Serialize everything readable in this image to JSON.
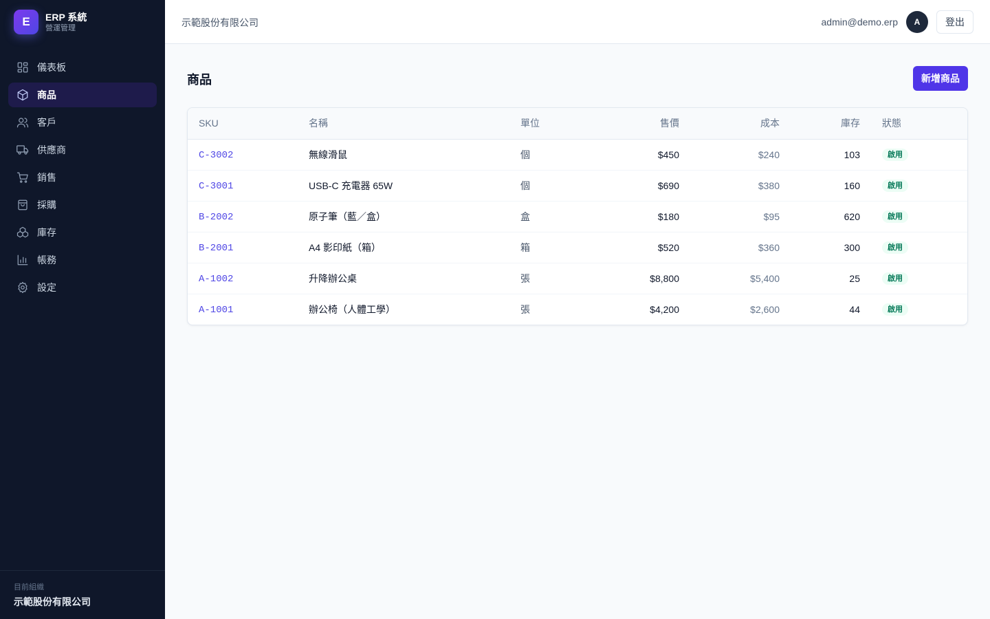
{
  "brand": {
    "logo_letter": "E",
    "title": "ERP 系統",
    "subtitle": "營運管理"
  },
  "sidebar": {
    "items": [
      {
        "label": "儀表板",
        "icon": "dashboard-icon",
        "active": false
      },
      {
        "label": "商品",
        "icon": "box-icon",
        "active": true
      },
      {
        "label": "客戶",
        "icon": "users-icon",
        "active": false
      },
      {
        "label": "供應商",
        "icon": "truck-icon",
        "active": false
      },
      {
        "label": "銷售",
        "icon": "cart-icon",
        "active": false
      },
      {
        "label": "採購",
        "icon": "bag-icon",
        "active": false
      },
      {
        "label": "庫存",
        "icon": "boxes-icon",
        "active": false
      },
      {
        "label": "帳務",
        "icon": "chart-icon",
        "active": false
      },
      {
        "label": "設定",
        "icon": "gear-icon",
        "active": false
      }
    ],
    "org_caption": "目前組織",
    "org_name": "示範股份有限公司"
  },
  "topbar": {
    "company": "示範股份有限公司",
    "user_email": "admin@demo.erp",
    "avatar_letter": "A",
    "logout_label": "登出"
  },
  "main": {
    "title": "商品",
    "add_label": "新增商品",
    "columns": [
      "SKU",
      "名稱",
      "單位",
      "售價",
      "成本",
      "庫存",
      "狀態"
    ],
    "rows": [
      {
        "sku": "C-3002",
        "name": "無線滑鼠",
        "unit": "個",
        "price": "$450",
        "cost": "$240",
        "stock": "103",
        "status": "啟用"
      },
      {
        "sku": "C-3001",
        "name": "USB-C 充電器 65W",
        "unit": "個",
        "price": "$690",
        "cost": "$380",
        "stock": "160",
        "status": "啟用"
      },
      {
        "sku": "B-2002",
        "name": "原子筆（藍／盒）",
        "unit": "盒",
        "price": "$180",
        "cost": "$95",
        "stock": "620",
        "status": "啟用"
      },
      {
        "sku": "B-2001",
        "name": "A4 影印紙（箱）",
        "unit": "箱",
        "price": "$520",
        "cost": "$360",
        "stock": "300",
        "status": "啟用"
      },
      {
        "sku": "A-1002",
        "name": "升降辦公桌",
        "unit": "張",
        "price": "$8,800",
        "cost": "$5,400",
        "stock": "25",
        "status": "啟用"
      },
      {
        "sku": "A-1001",
        "name": "辦公椅（人體工學）",
        "unit": "張",
        "price": "$4,200",
        "cost": "$2,600",
        "stock": "44",
        "status": "啟用"
      }
    ]
  },
  "colors": {
    "accent": "#4f35e8",
    "sidebar_bg": "#0f172a",
    "active_bg": "#1e1b4b",
    "status_green": "#047857"
  }
}
